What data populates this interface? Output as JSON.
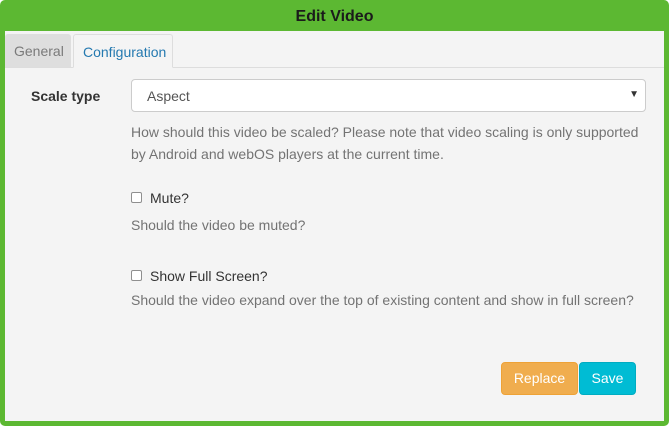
{
  "dialog": {
    "title": "Edit Video"
  },
  "tabs": [
    {
      "label": "General",
      "active": false
    },
    {
      "label": "Configuration",
      "active": true
    }
  ],
  "scale_type": {
    "label": "Scale type",
    "value": "Aspect",
    "help": "How should this video be scaled? Please note that video scaling is only supported by Android and webOS players at the current time."
  },
  "mute": {
    "label": "Mute?",
    "checked": false,
    "help": "Should the video be muted?"
  },
  "full_screen": {
    "label": "Show Full Screen?",
    "checked": false,
    "help": "Should the video expand over the top of existing content and show in full screen?"
  },
  "buttons": {
    "replace": "Replace",
    "save": "Save"
  },
  "colors": {
    "frame": "#5cb832",
    "replace": "#f0ad4e",
    "save": "#00bcd4",
    "active_tab_text": "#2479b0"
  }
}
